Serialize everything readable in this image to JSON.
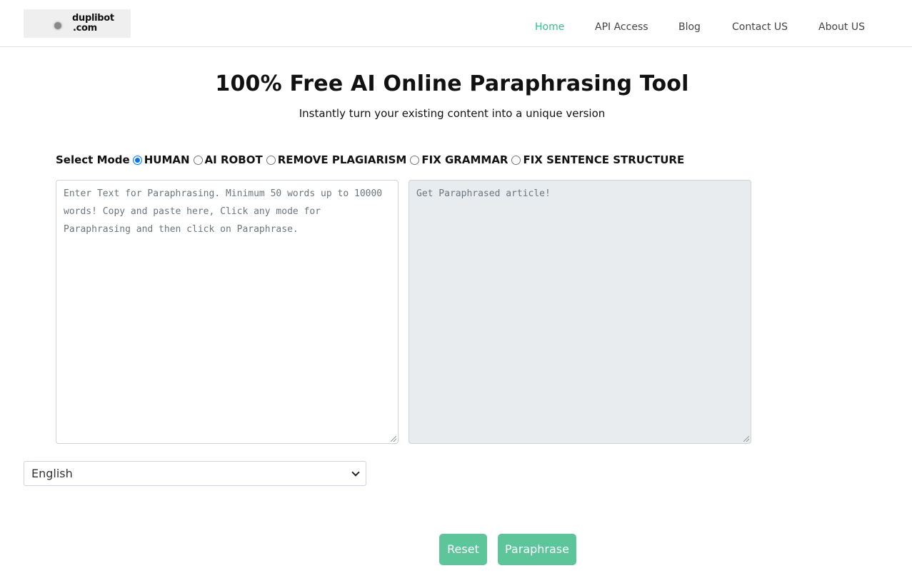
{
  "header": {
    "logo": {
      "line1": "duplibot",
      "line2": ".com"
    },
    "nav": [
      {
        "label": "Home",
        "active": true
      },
      {
        "label": "API Access",
        "active": false
      },
      {
        "label": "Blog",
        "active": false
      },
      {
        "label": "Contact US",
        "active": false
      },
      {
        "label": "About US",
        "active": false
      }
    ]
  },
  "hero": {
    "title": "100% Free AI Online Paraphrasing Tool",
    "subtitle": "Instantly turn your existing content into a unique version"
  },
  "modes": {
    "label": "Select Mode",
    "selected": "HUMAN",
    "options": [
      "HUMAN",
      "AI ROBOT",
      "REMOVE PLAGIARISM",
      "FIX GRAMMAR",
      "FIX SENTENCE STRUCTURE"
    ]
  },
  "editor": {
    "input": {
      "value": "",
      "placeholder": "Enter Text for Paraphrasing. Minimum 50 words up to 10000 words! Copy and paste here, Click any mode for Paraphrasing and then click on Paraphrase."
    },
    "output": {
      "value": "",
      "placeholder": "Get Paraphrased article!"
    }
  },
  "language": {
    "selected": "English"
  },
  "actions": {
    "reset": "Reset",
    "paraphrase": "Paraphrase"
  },
  "colors": {
    "accent": "#3cbc8d",
    "button": "#5cc69a",
    "radio_checked": "#0075ff",
    "output_bg": "#e9ecef"
  }
}
